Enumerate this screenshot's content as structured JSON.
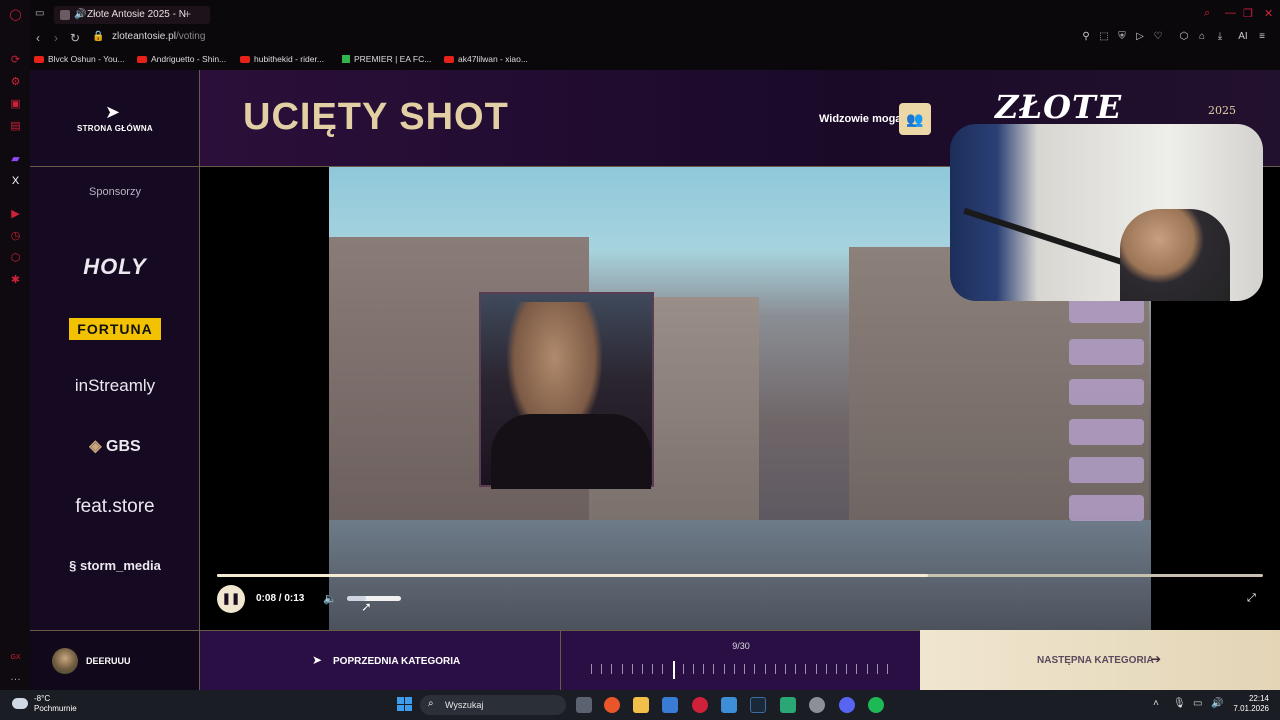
{
  "browser": {
    "tab_title": "Złote Antosie 2025 - N",
    "url_domain": "zloteantosie.pl",
    "url_path": "/voting",
    "bookmarks": [
      "Blvck Oshun - You...",
      "Andriguetto - Shin...",
      "hubithekid - rider...",
      "PREMIER | EA FC...",
      "ak47lilwan - xiao..."
    ],
    "sidebar_label_gx": "GX",
    "toolbar_ai": "AI"
  },
  "site": {
    "home_label": "STRONA GŁÓWNA",
    "category_title": "UCIĘTY SHOT",
    "viewers_label": "Widzowie mogą",
    "brand_logo": "ZŁOTE",
    "brand_year": "2025",
    "sponsors_title": "Sponsorzy",
    "sponsors": [
      "HOLY",
      "FORTUNA",
      "inStreamly",
      "GBS",
      "feat.store",
      "storm_media"
    ],
    "video": {
      "time": "0:08 / 0:13",
      "progress_fraction": 0.68,
      "volume_fraction": 0.35
    },
    "footer": {
      "username": "DEERUUU",
      "prev_label": "POPRZEDNIA KATEGORIA",
      "next_label": "NASTĘPNA KATEGORIA",
      "counter": "9/30",
      "current": 9,
      "total": 30
    }
  },
  "taskbar": {
    "temp": "-8°C",
    "weather": "Pochmurnie",
    "search_placeholder": "Wyszukaj",
    "time": "22:14",
    "date": "7.01.2026"
  },
  "colors": {
    "accent_gold": "#e3cfa4",
    "bg_purple": "#2a0f45",
    "gx_red": "#d0213a"
  }
}
